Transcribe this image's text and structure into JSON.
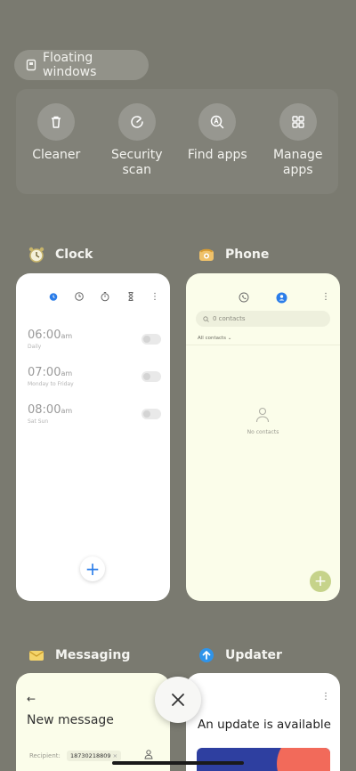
{
  "floating_windows": {
    "label": "Floating windows"
  },
  "tools": [
    {
      "label": "Cleaner",
      "icon": "trash-icon"
    },
    {
      "label": "Security scan",
      "icon": "speedometer-icon"
    },
    {
      "label": "Find apps",
      "icon": "find-apps-icon"
    },
    {
      "label": "Manage apps",
      "icon": "grid-icon"
    }
  ],
  "apps": {
    "clock": {
      "name": "Clock",
      "alarms": [
        {
          "time": "06:00",
          "ampm": "am",
          "repeat": "Daily"
        },
        {
          "time": "07:00",
          "ampm": "am",
          "repeat": "Monday to Friday"
        },
        {
          "time": "08:00",
          "ampm": "am",
          "repeat": "Sat Sun"
        }
      ]
    },
    "phone": {
      "name": "Phone",
      "search_placeholder": "0 contacts",
      "filter": "All contacts",
      "empty": "No contacts"
    },
    "messaging": {
      "name": "Messaging",
      "title": "New message",
      "recipient_label": "Recipient:",
      "recipient_value": "18730218809"
    },
    "updater": {
      "name": "Updater",
      "title": "An update is available"
    }
  },
  "colors": {
    "background": "#7a7a70",
    "accent_blue": "#2b7de9",
    "phone_bg": "#fbfdea"
  }
}
